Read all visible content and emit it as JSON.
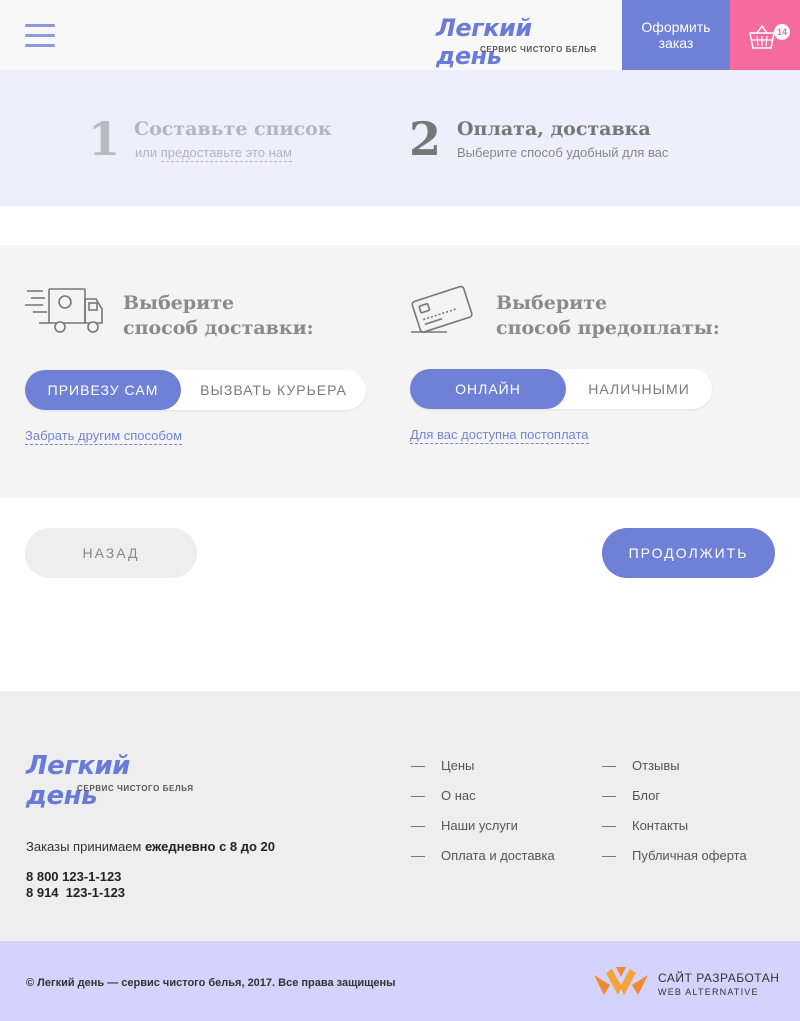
{
  "header": {
    "menu_icon": "hamburger-menu-icon",
    "logo_title": "Легкий день",
    "logo_subtitle": "СЕРВИС ЧИСТОГО БЕЛЬЯ",
    "order_line1": "Оформить",
    "order_line2": "заказ",
    "cart_icon": "basket-icon",
    "cart_count": "14"
  },
  "steps": {
    "step1": {
      "number": "1",
      "title": "Составьте список",
      "sub_prefix": "или",
      "sub_link": "предоставьте это нам"
    },
    "step2": {
      "number": "2",
      "title": "Оплата, доставка",
      "sub": "Выберите способ удобный для вас"
    }
  },
  "delivery": {
    "icon": "delivery-truck-icon",
    "title_line1": "Выберите",
    "title_line2": "способ доставки:",
    "options": [
      "ПРИВЕЗУ САМ",
      "ВЫЗВАТЬ КУРЬЕРА"
    ],
    "selected": "ПРИВЕЗУ САМ",
    "link": "Забрать другим способом"
  },
  "payment": {
    "icon": "credit-card-icon",
    "title_line1": "Выберите",
    "title_line2": "способ предоплаты:",
    "options": [
      "ОНЛАЙН",
      "НАЛИЧНЫМИ"
    ],
    "selected": "ОНЛАЙН",
    "link": "Для вас доступна постоплата"
  },
  "actions": {
    "back": "НАЗАД",
    "next": "ПРОДОЛЖИТЬ"
  },
  "footer": {
    "logo_title": "Легкий день",
    "logo_subtitle": "СЕРВИС ЧИСТОГО БЕЛЬЯ",
    "orders_prefix": "Заказы  принимаем",
    "orders_hours": "ежедневно с 8 до 20",
    "phone1": "8 800 123-1-123",
    "phone2": "8 914  123-1-123",
    "nav_col1": [
      "Цены",
      "О нас",
      "Наши услуги",
      "Оплата и доставка"
    ],
    "nav_col2": [
      "Отзывы",
      "Блог",
      "Контакты",
      "Публичная оферта"
    ],
    "copyright": "© Легкий день — сервис чистого белья, 2017. Все права защищены",
    "developer_line1": "САЙТ РАЗРАБОТАН",
    "developer_line2": "WEB ALTERNATIVE",
    "developer_icon": "web-alternative-logo-icon"
  },
  "colors": {
    "accent": "#6f80d6",
    "cart": "#f56b9e",
    "steps_bg": "#eeeefc",
    "bottom_bar": "#d3d3fd"
  }
}
